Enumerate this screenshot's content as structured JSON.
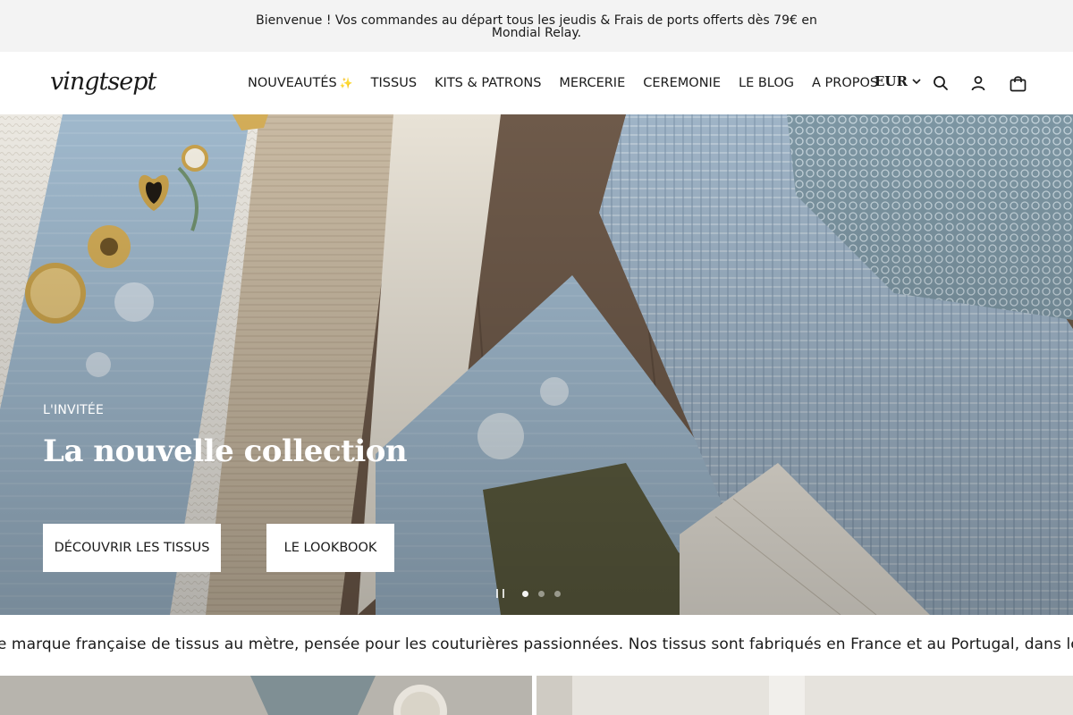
{
  "announcement": {
    "text": "Bienvenue ! Vos commandes au départ tous les jeudis & Frais de ports offerts dès 79€ en Mondial Relay."
  },
  "header": {
    "logo": "vingtsept",
    "nav": [
      {
        "label": "NOUVEAUTÉS",
        "icon": "sparkles-icon"
      },
      {
        "label": "TISSUS"
      },
      {
        "label": "KITS & PATRONS"
      },
      {
        "label": "MERCERIE"
      },
      {
        "label": "CEREMONIE"
      },
      {
        "label": "LE BLOG"
      },
      {
        "label": "A PROPOS"
      }
    ],
    "currency": "EUR",
    "icons": [
      "search-icon",
      "account-icon",
      "cart-icon"
    ]
  },
  "hero": {
    "eyebrow": "L'INVITÉE",
    "headline": "La nouvelle collection",
    "buttons": {
      "primary": "DÉCOUVRIR LES TISSUS",
      "secondary": "LE LOOKBOOK"
    },
    "slides": {
      "count": 3,
      "active": 1
    }
  },
  "marquee": {
    "text": "ne marque française de tissus au mètre, pensée pour les couturières passionnées. Nos tissus sont fabriqués en France et au Portugal, dans le resp"
  },
  "colors": {
    "announcement_bg": "#f3f3f3",
    "text": "#1a1a1a",
    "button_bg": "#ffffff",
    "spark": "#e8b93a"
  }
}
